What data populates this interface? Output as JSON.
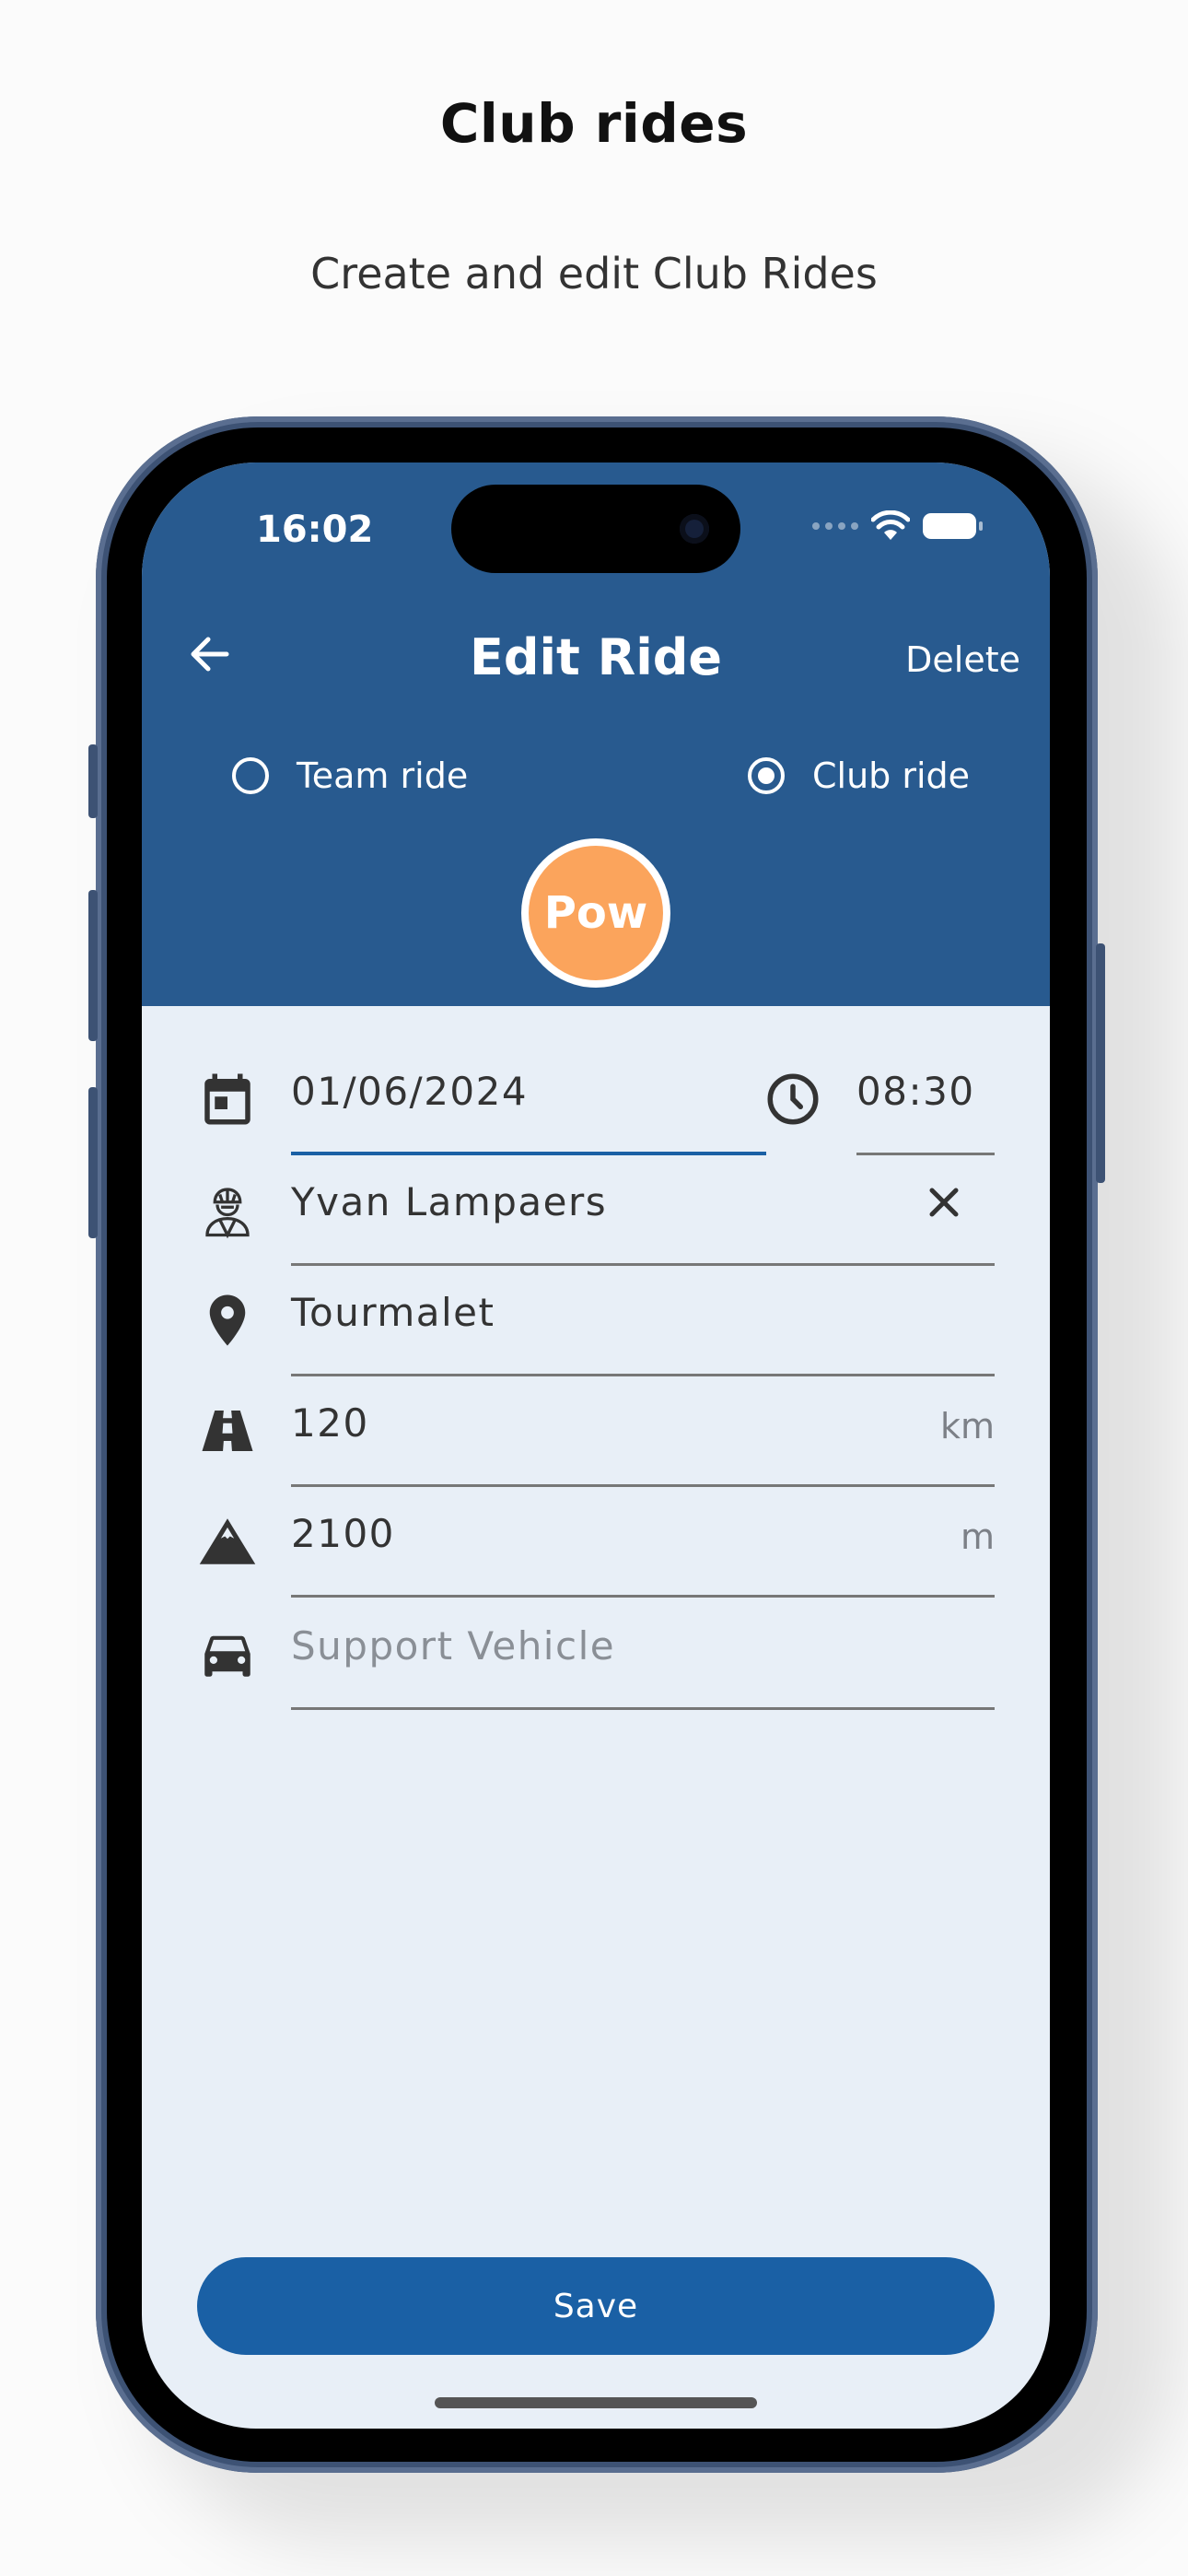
{
  "promo": {
    "title": "Club rides",
    "subtitle": "Create and edit Club Rides"
  },
  "status_bar": {
    "time": "16:02",
    "icons": [
      "cellular-icon",
      "wifi-icon",
      "battery-icon"
    ]
  },
  "appbar": {
    "back_icon": "arrow-left-icon",
    "title": "Edit Ride",
    "delete_label": "Delete"
  },
  "ride_type": {
    "options": [
      {
        "label": "Team ride",
        "selected": false
      },
      {
        "label": "Club ride",
        "selected": true
      }
    ]
  },
  "avatar": {
    "initials": "Pow",
    "color": "#fba45c"
  },
  "form": {
    "date": {
      "value": "01/06/2024",
      "icon": "calendar-icon"
    },
    "time": {
      "value": "08:30",
      "icon": "clock-icon"
    },
    "rider": {
      "value": "Yvan Lampaers",
      "icon": "cyclist-icon",
      "clear_icon": "close-icon"
    },
    "location": {
      "value": "Tourmalet",
      "icon": "location-pin-icon"
    },
    "distance": {
      "value": "120",
      "unit": "km",
      "icon": "road-icon"
    },
    "elevation": {
      "value": "2100",
      "unit": "m",
      "icon": "mountain-icon"
    },
    "support_vehicle": {
      "value": "",
      "placeholder": "Support Vehicle",
      "icon": "car-icon"
    }
  },
  "save_label": "Save",
  "colors": {
    "header": "#285a8f",
    "accent": "#1a60a5",
    "background": "#e8eff7",
    "avatar": "#fba45c"
  }
}
